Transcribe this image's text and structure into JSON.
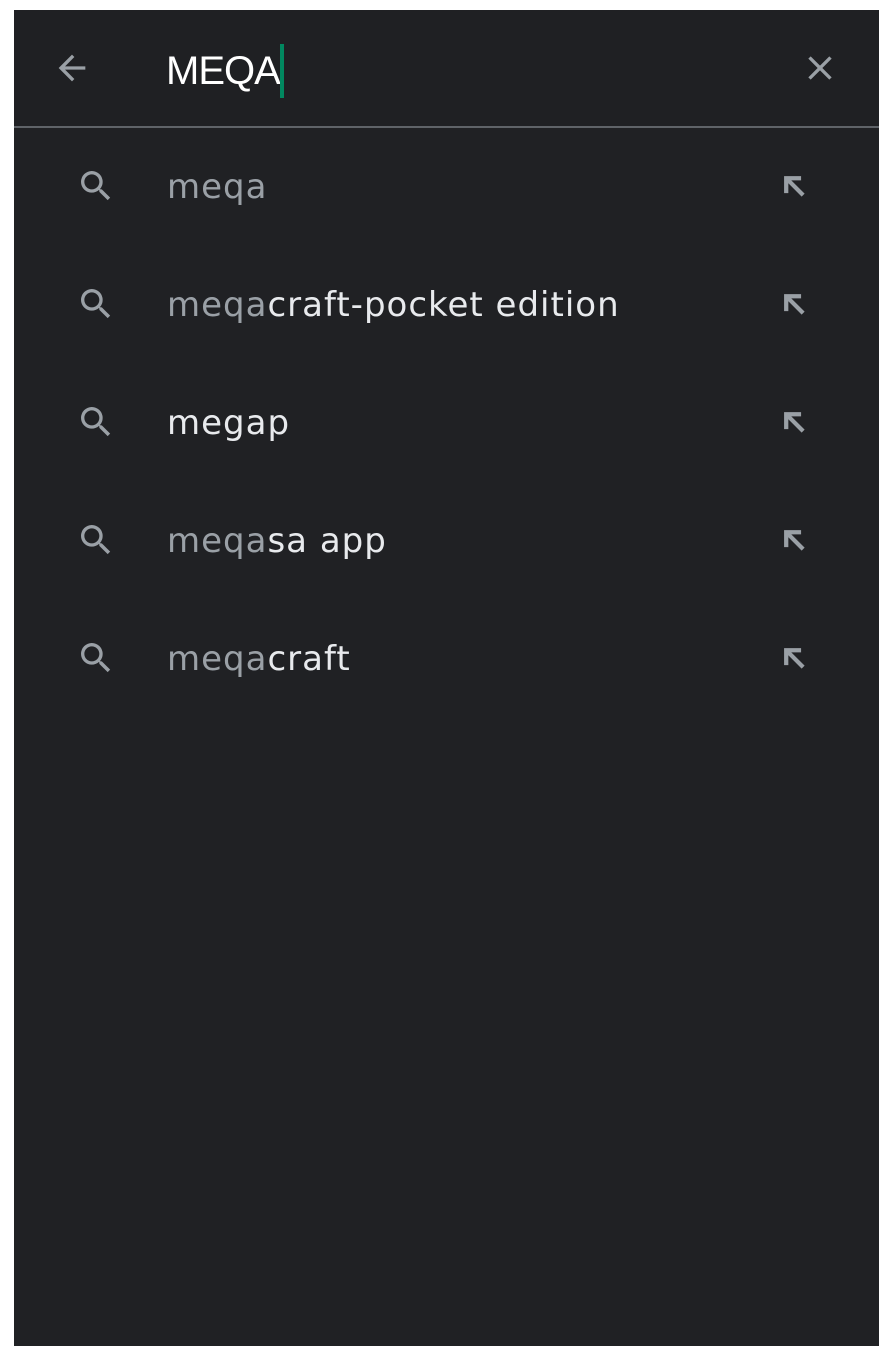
{
  "search": {
    "query": "MEQA"
  },
  "suggestions": [
    {
      "prefix": "meqa",
      "suffix": ""
    },
    {
      "prefix": "meqa",
      "suffix": "craft-pocket edition"
    },
    {
      "prefix": "",
      "suffix": "megap"
    },
    {
      "prefix": "meqa",
      "suffix": "sa app"
    },
    {
      "prefix": "meqa",
      "suffix": "craft"
    }
  ],
  "icons": {
    "back": "arrow-back-icon",
    "clear": "close-icon",
    "suggestion": "search-icon",
    "fill": "arrow-up-left-icon"
  },
  "colors": {
    "background": "#202124",
    "caret": "#01875f",
    "matched_text": "#9aa0a6",
    "completion_text": "#e8eaed"
  }
}
